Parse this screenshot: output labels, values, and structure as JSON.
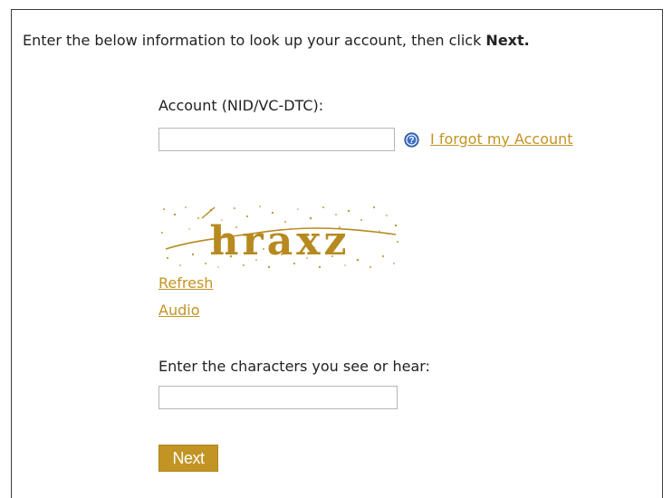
{
  "intro": {
    "text": "Enter the below information to look up your account, then click ",
    "bold": "Next."
  },
  "account": {
    "label": "Account (NID/VC-DTC):",
    "value": "",
    "help_icon": "question-circle-icon",
    "forgot_link": "I forgot my Account"
  },
  "captcha": {
    "text": "hraxz",
    "refresh_link": "Refresh",
    "audio_link": "Audio"
  },
  "characters": {
    "label": "Enter the characters you see or hear:",
    "value": ""
  },
  "next_button": "Next",
  "colors": {
    "link": "#c29424",
    "button": "#c29424",
    "help_icon": "#3d6fc4",
    "captcha": "#b68a1f"
  }
}
